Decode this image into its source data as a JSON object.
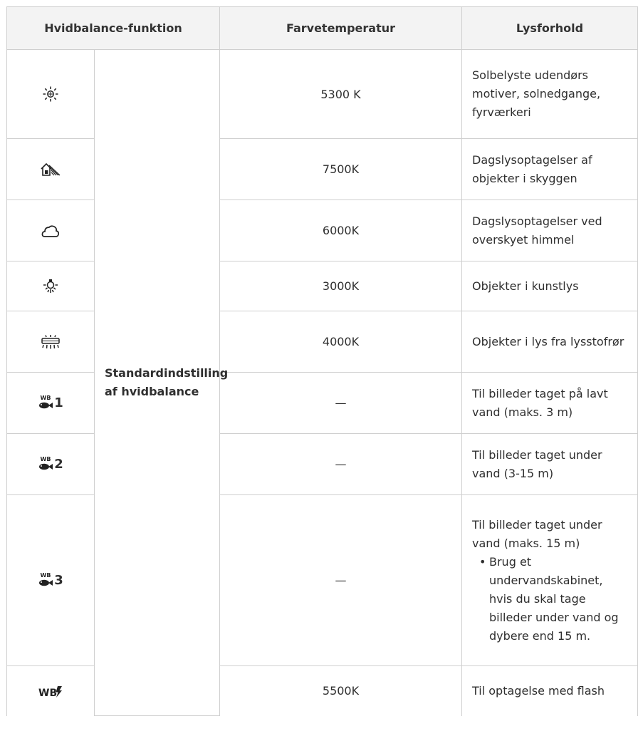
{
  "header": {
    "mode": "Hvidbalance-funktion",
    "temp": "Farvetemperatur",
    "light": "Lysforhold"
  },
  "standard_label": "Standardindstilling af hvidbalance",
  "rows": [
    {
      "icon": "sunny-icon",
      "temp": "5300 K",
      "desc": "Solbelyste udendørs motiver, solnedgange, fyrværkeri"
    },
    {
      "icon": "shade-icon",
      "temp": "7500K",
      "desc": "Dagslysoptagelser af objekter i skyggen"
    },
    {
      "icon": "cloudy-icon",
      "temp": "6000K",
      "desc": "Dagslysoptagelser ved overskyet himmel"
    },
    {
      "icon": "tungsten-icon",
      "temp": "3000K",
      "desc": "Objekter i kunstlys"
    },
    {
      "icon": "fluorescent-icon",
      "temp": "4000K",
      "desc": "Objekter i lys fra lysstofrør"
    },
    {
      "icon": "underwater-wb1-icon",
      "icon_num": "1",
      "temp": "—",
      "desc": "Til billeder taget på lavt vand (maks. 3 m)"
    },
    {
      "icon": "underwater-wb2-icon",
      "icon_num": "2",
      "temp": "—",
      "desc": "Til billeder taget under vand (3-15 m)"
    },
    {
      "icon": "underwater-wb3-icon",
      "icon_num": "3",
      "temp": "—",
      "desc": "Til billeder taget under vand (maks. 15 m)",
      "bullet": "Brug et undervandskabinet, hvis du skal tage billeder under vand og dybere end 15 m."
    },
    {
      "icon": "wb-flash-icon",
      "temp": "5500K",
      "desc": "Til optagelse med flash"
    }
  ]
}
